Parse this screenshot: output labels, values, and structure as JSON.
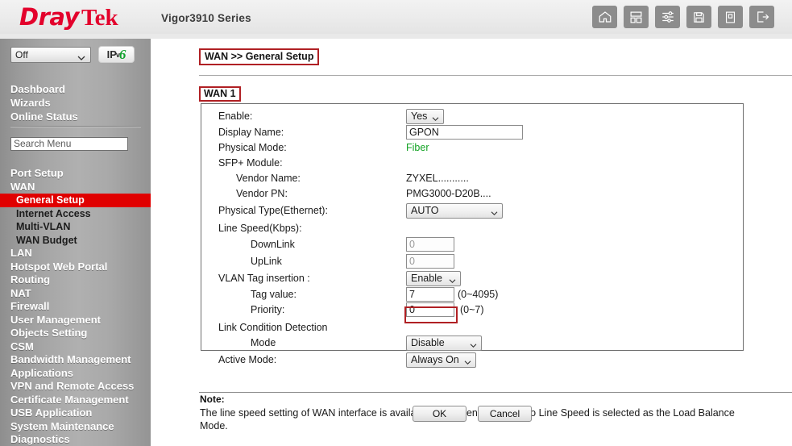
{
  "header": {
    "logo_dray": "Dray",
    "logo_tek": "Tek",
    "model": "Vigor3910 Series",
    "icons": [
      {
        "name": "home-icon",
        "label": "Home"
      },
      {
        "name": "dashboard-icon",
        "label": "Dashboard"
      },
      {
        "name": "settings-sliders-icon",
        "label": "Settings"
      },
      {
        "name": "save-icon",
        "label": "Save"
      },
      {
        "name": "manual-icon",
        "label": "Manual"
      },
      {
        "name": "logout-icon",
        "label": "Logout"
      }
    ]
  },
  "sidebar": {
    "mode_select": {
      "value": "Off"
    },
    "ipv6_button": {
      "ip": "IP",
      "v": "v",
      "six": "6"
    },
    "top_items": [
      "Dashboard",
      "Wizards",
      "Online Status"
    ],
    "search": {
      "placeholder": "Search Menu",
      "value": ""
    },
    "menu": [
      {
        "label": "Port Setup",
        "level": 0,
        "active": false
      },
      {
        "label": "WAN",
        "level": 0,
        "active": false
      },
      {
        "label": "General Setup",
        "level": 1,
        "active": true
      },
      {
        "label": "Internet Access",
        "level": 1,
        "active": false
      },
      {
        "label": "Multi-VLAN",
        "level": 1,
        "active": false
      },
      {
        "label": "WAN Budget",
        "level": 1,
        "active": false
      },
      {
        "label": "LAN",
        "level": 0,
        "active": false
      },
      {
        "label": "Hotspot Web Portal",
        "level": 0,
        "active": false
      },
      {
        "label": "Routing",
        "level": 0,
        "active": false
      },
      {
        "label": "NAT",
        "level": 0,
        "active": false
      },
      {
        "label": "Firewall",
        "level": 0,
        "active": false
      },
      {
        "label": "User Management",
        "level": 0,
        "active": false
      },
      {
        "label": "Objects Setting",
        "level": 0,
        "active": false
      },
      {
        "label": "CSM",
        "level": 0,
        "active": false
      },
      {
        "label": "Bandwidth Management",
        "level": 0,
        "active": false
      },
      {
        "label": "Applications",
        "level": 0,
        "active": false
      },
      {
        "label": "VPN and Remote Access",
        "level": 0,
        "active": false
      },
      {
        "label": "Certificate Management",
        "level": 0,
        "active": false
      },
      {
        "label": "USB Application",
        "level": 0,
        "active": false
      },
      {
        "label": "System Maintenance",
        "level": 0,
        "active": false
      },
      {
        "label": "Diagnostics",
        "level": 0,
        "active": false
      }
    ]
  },
  "main": {
    "breadcrumb": "WAN >> General Setup",
    "panel_title": "WAN 1",
    "fields": {
      "enable_label": "Enable:",
      "enable_value": "Yes",
      "display_name_label": "Display Name:",
      "display_name_value": "GPON",
      "physical_mode_label": "Physical Mode:",
      "physical_mode_value": "Fiber",
      "sfp_module_label": "SFP+ Module:",
      "vendor_name_label": "Vendor Name:",
      "vendor_name_value": "ZYXEL...........",
      "vendor_pn_label": "Vendor PN:",
      "vendor_pn_value": "PMG3000-D20B....",
      "physical_type_label": "Physical Type(Ethernet):",
      "physical_type_value": "AUTO",
      "line_speed_label": "Line Speed(Kbps):",
      "downlink_label": "DownLink",
      "downlink_value": "0",
      "uplink_label": "UpLink",
      "uplink_value": "0",
      "vlan_tag_label": "VLAN Tag insertion :",
      "vlan_tag_value": "Enable",
      "tag_value_label": "Tag value:",
      "tag_value_value": "7",
      "tag_value_range": "(0~4095)",
      "priority_label": "Priority:",
      "priority_value": "0",
      "priority_range": "(0~7)",
      "link_condition_label": "Link Condition Detection",
      "mode_label": "Mode",
      "mode_value": "Disable",
      "active_mode_label": "Active Mode:",
      "active_mode_value": "Always On"
    },
    "note_title": "Note:",
    "note_body": "The line speed setting of WAN interface is available only when According to Line Speed is selected as the Load Balance Mode.",
    "ok_button": "OK",
    "cancel_button": "Cancel"
  },
  "colors": {
    "brand_red": "#e3022c",
    "active_menu": "#e00000",
    "highlight_border": "#b02024",
    "fiber_green": "#13a324"
  }
}
